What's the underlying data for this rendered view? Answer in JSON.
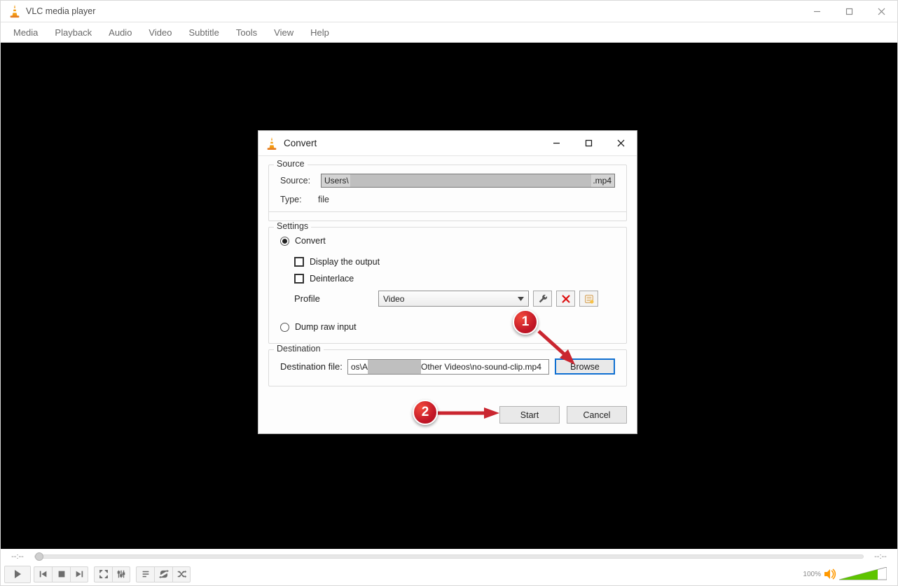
{
  "app": {
    "title": "VLC media player",
    "menus": [
      "Media",
      "Playback",
      "Audio",
      "Video",
      "Subtitle",
      "Tools",
      "View",
      "Help"
    ]
  },
  "seek": {
    "time_left": "--:--",
    "time_right": "--:--"
  },
  "volume": {
    "label": "100%"
  },
  "dialog": {
    "title": "Convert",
    "source_section": {
      "legend": "Source",
      "source_label": "Source:",
      "source_prefix": "Users\\",
      "source_suffix": ".mp4",
      "type_label": "Type:",
      "type_value": "file"
    },
    "settings_section": {
      "legend": "Settings",
      "convert_label": "Convert",
      "display_output_label": "Display the output",
      "deinterlace_label": "Deinterlace",
      "profile_label": "Profile",
      "profile_value": "Video",
      "dump_raw_label": "Dump raw input"
    },
    "destination_section": {
      "legend": "Destination",
      "dest_file_label": "Destination file:",
      "dest_prefix": "os\\A",
      "dest_suffix": "Other Videos\\no-sound-clip.mp4",
      "browse_label": "Browse"
    },
    "actions": {
      "start": "Start",
      "cancel": "Cancel"
    }
  },
  "annotations": {
    "badge1": "1",
    "badge2": "2"
  }
}
